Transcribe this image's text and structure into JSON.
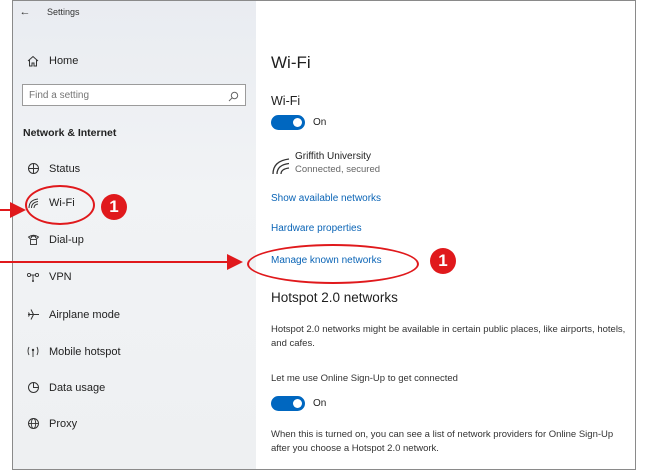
{
  "window": {
    "title": "Settings"
  },
  "sidebar": {
    "home_label": "Home",
    "search_placeholder": "Find a setting",
    "section_title": "Network & Internet",
    "items": [
      {
        "label": "Status",
        "icon": "status-icon"
      },
      {
        "label": "Wi-Fi",
        "icon": "wifi-icon"
      },
      {
        "label": "Dial-up",
        "icon": "dialup-icon"
      },
      {
        "label": "VPN",
        "icon": "vpn-icon"
      },
      {
        "label": "Airplane mode",
        "icon": "airplane-icon"
      },
      {
        "label": "Mobile hotspot",
        "icon": "hotspot-icon"
      },
      {
        "label": "Data usage",
        "icon": "data-usage-icon"
      },
      {
        "label": "Proxy",
        "icon": "proxy-icon"
      }
    ]
  },
  "main": {
    "page_title": "Wi-Fi",
    "wifi_heading": "Wi-Fi",
    "wifi_toggle_state": "On",
    "network": {
      "name": "Griffith University",
      "status": "Connected, secured"
    },
    "links": {
      "show_available": "Show available networks",
      "hardware": "Hardware properties",
      "manage_known": "Manage known networks"
    },
    "hotspot": {
      "heading": "Hotspot 2.0 networks",
      "description": "Hotspot 2.0 networks might be available in certain public places, like airports, hotels, and cafes.",
      "signup_label": "Let me use Online Sign-Up to get connected",
      "signup_toggle_state": "On",
      "footer": "When this is turned on, you can see a list of network providers for Online Sign-Up after you choose a Hotspot 2.0 network."
    }
  },
  "annotations": {
    "marker_1": "1",
    "marker_2": "1",
    "color": "#e0191c"
  },
  "colors": {
    "accent": "#0067c0",
    "link": "#0a64b6"
  }
}
